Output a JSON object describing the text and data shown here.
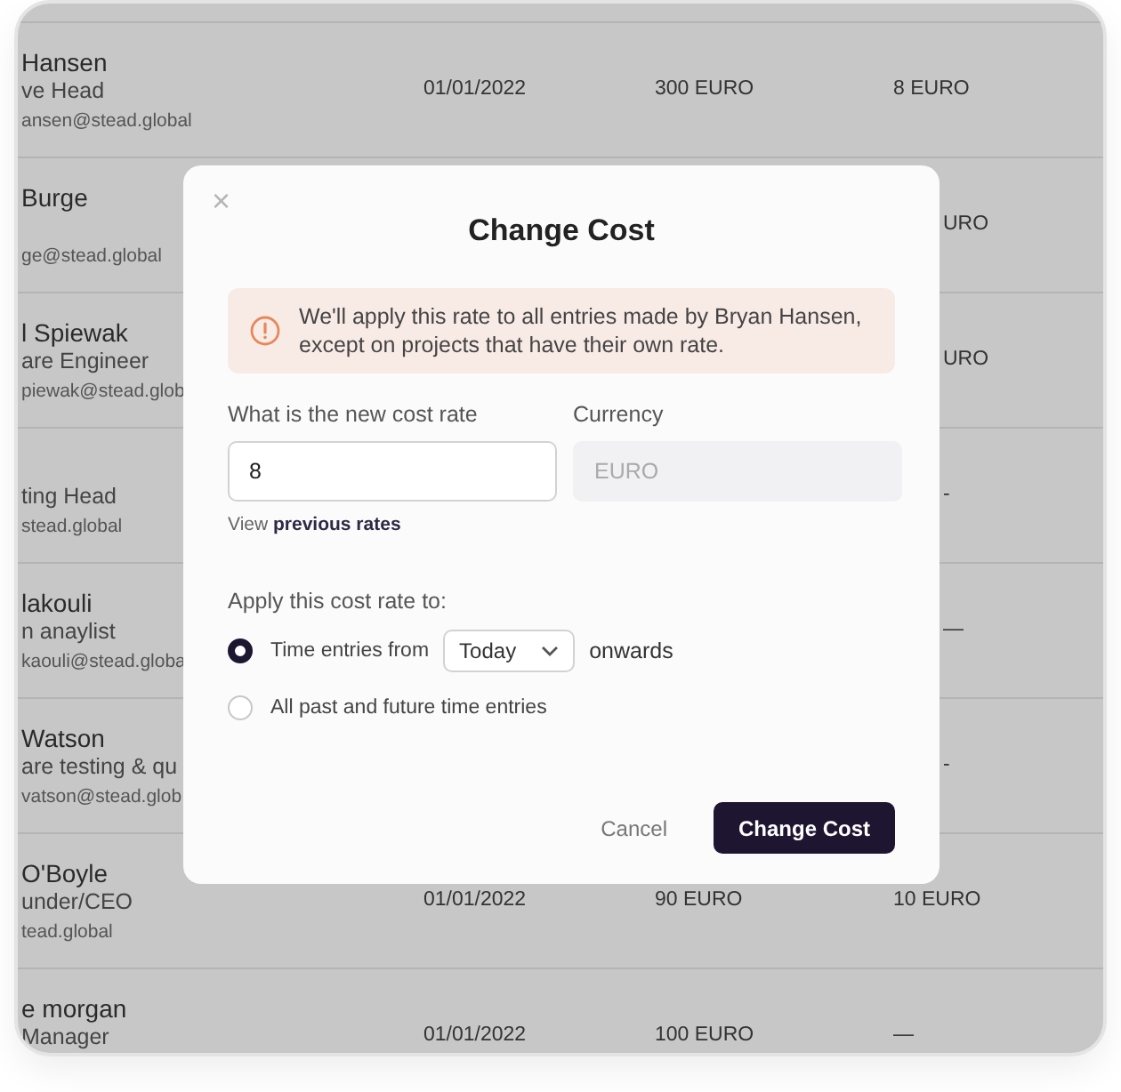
{
  "table": {
    "rows": [
      {
        "name": "Hansen",
        "role": "ve Head",
        "email": "ansen@stead.global",
        "date": "01/01/2022",
        "amount": "300 EURO",
        "rate": "8 EURO"
      },
      {
        "name": "Burge",
        "email": "ge@stead.global",
        "rate": "URO"
      },
      {
        "name": "l Spiewak",
        "role": "are Engineer",
        "email": "piewak@stead.glob",
        "rate": "URO"
      },
      {
        "role": "ting Head",
        "email": "stead.global",
        "rate": "-"
      },
      {
        "name": "lakouli",
        "role": "n anaylist",
        "email": "kaouli@stead.globa",
        "rate": "—"
      },
      {
        "name": "Watson",
        "role": "are testing & qu",
        "email": "vatson@stead.glob",
        "rate": "-"
      },
      {
        "name": "O'Boyle",
        "role": "under/CEO",
        "email": "tead.global",
        "date": "01/01/2022",
        "amount": "90 EURO",
        "rate": "10 EURO"
      },
      {
        "name": "e morgan",
        "role": "Manager",
        "date": "01/01/2022",
        "amount": "100 EURO",
        "rate": "—"
      }
    ]
  },
  "modal": {
    "close": "×",
    "title": "Change Cost",
    "alert": "We'll apply this rate to all entries made by Bryan Hansen, except on projects that have their own rate.",
    "rate_label": "What is the new cost rate",
    "rate_value": "8",
    "currency_label": "Currency",
    "currency_value": "EURO",
    "history_link": "View **previous rates**",
    "apply_label": "Apply this cost rate to:",
    "options": [
      {
        "kind": "date_from",
        "selected": true,
        "prefix": "Time entries from",
        "dropdown": "Today",
        "suffix": "onwards"
      },
      {
        "kind": "plain",
        "selected": false,
        "label": "All past and future time entries"
      }
    ],
    "buttons": {
      "cancel": "Cancel",
      "confirm": "Change Cost"
    }
  }
}
